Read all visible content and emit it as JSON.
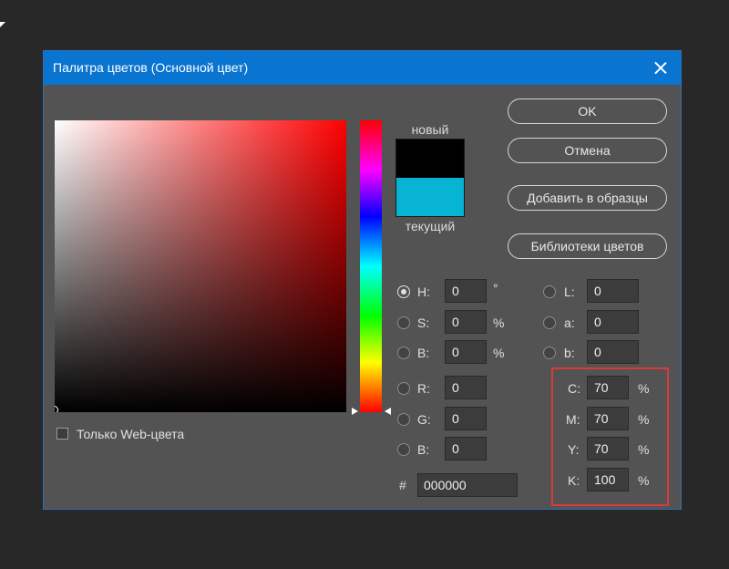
{
  "dialog": {
    "title": "Палитра цветов (Основной цвет)"
  },
  "swatch": {
    "new_label": "новый",
    "current_label": "текущий",
    "new_color": "#000000",
    "current_color": "#07b4d4"
  },
  "buttons": {
    "ok": "OK",
    "cancel": "Отмена",
    "add_to_swatches": "Добавить в образцы",
    "color_libraries": "Библиотеки цветов"
  },
  "hsb": {
    "h": {
      "label": "H:",
      "value": "0",
      "unit": "°",
      "selected": true
    },
    "s": {
      "label": "S:",
      "value": "0",
      "unit": "%"
    },
    "b": {
      "label": "B:",
      "value": "0",
      "unit": "%"
    }
  },
  "rgb": {
    "r": {
      "label": "R:",
      "value": "0"
    },
    "g": {
      "label": "G:",
      "value": "0"
    },
    "b": {
      "label": "B:",
      "value": "0"
    }
  },
  "lab": {
    "l": {
      "label": "L:",
      "value": "0"
    },
    "a": {
      "label": "a:",
      "value": "0"
    },
    "b": {
      "label": "b:",
      "value": "0"
    }
  },
  "cmyk": {
    "c": {
      "label": "C:",
      "value": "70",
      "unit": "%"
    },
    "m": {
      "label": "M:",
      "value": "70",
      "unit": "%"
    },
    "y": {
      "label": "Y:",
      "value": "70",
      "unit": "%"
    },
    "k": {
      "label": "K:",
      "value": "100",
      "unit": "%"
    }
  },
  "hex": {
    "symbol": "#",
    "value": "000000"
  },
  "web_only": {
    "label": "Только Web-цвета",
    "checked": false
  },
  "colors": {
    "titlebar": "#0a74d1",
    "dialog_bg": "#535353",
    "highlight": "#d93a3a"
  }
}
